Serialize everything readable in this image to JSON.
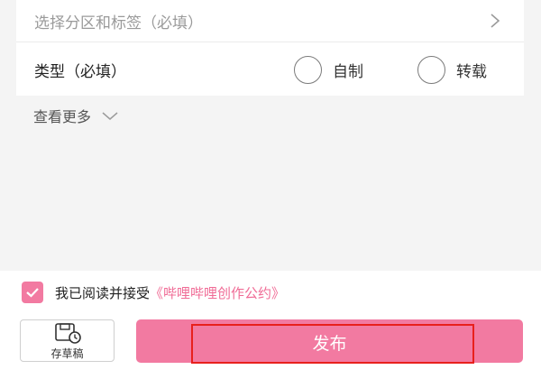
{
  "form": {
    "zone_tag": {
      "placeholder": "选择分区和标签（必填）"
    },
    "type": {
      "label": "类型（必填）",
      "options": [
        "自制",
        "转载"
      ]
    },
    "see_more": "查看更多"
  },
  "footer": {
    "agreement": {
      "checked": true,
      "prefix": "我已阅读并接受",
      "link_text": "《哔哩哔哩创作公约》"
    },
    "draft_label": "存草稿",
    "publish_label": "发布"
  },
  "colors": {
    "accent": "#f27aa1",
    "link": "#f06c96",
    "highlight": "#e8201d",
    "background": "#f4f4f4"
  },
  "icons": {
    "zone_chevron": "chevron-right-icon",
    "see_more_chevron": "chevron-down-icon",
    "checkbox": "checkmark-icon",
    "draft": "draft-clock-icon"
  }
}
